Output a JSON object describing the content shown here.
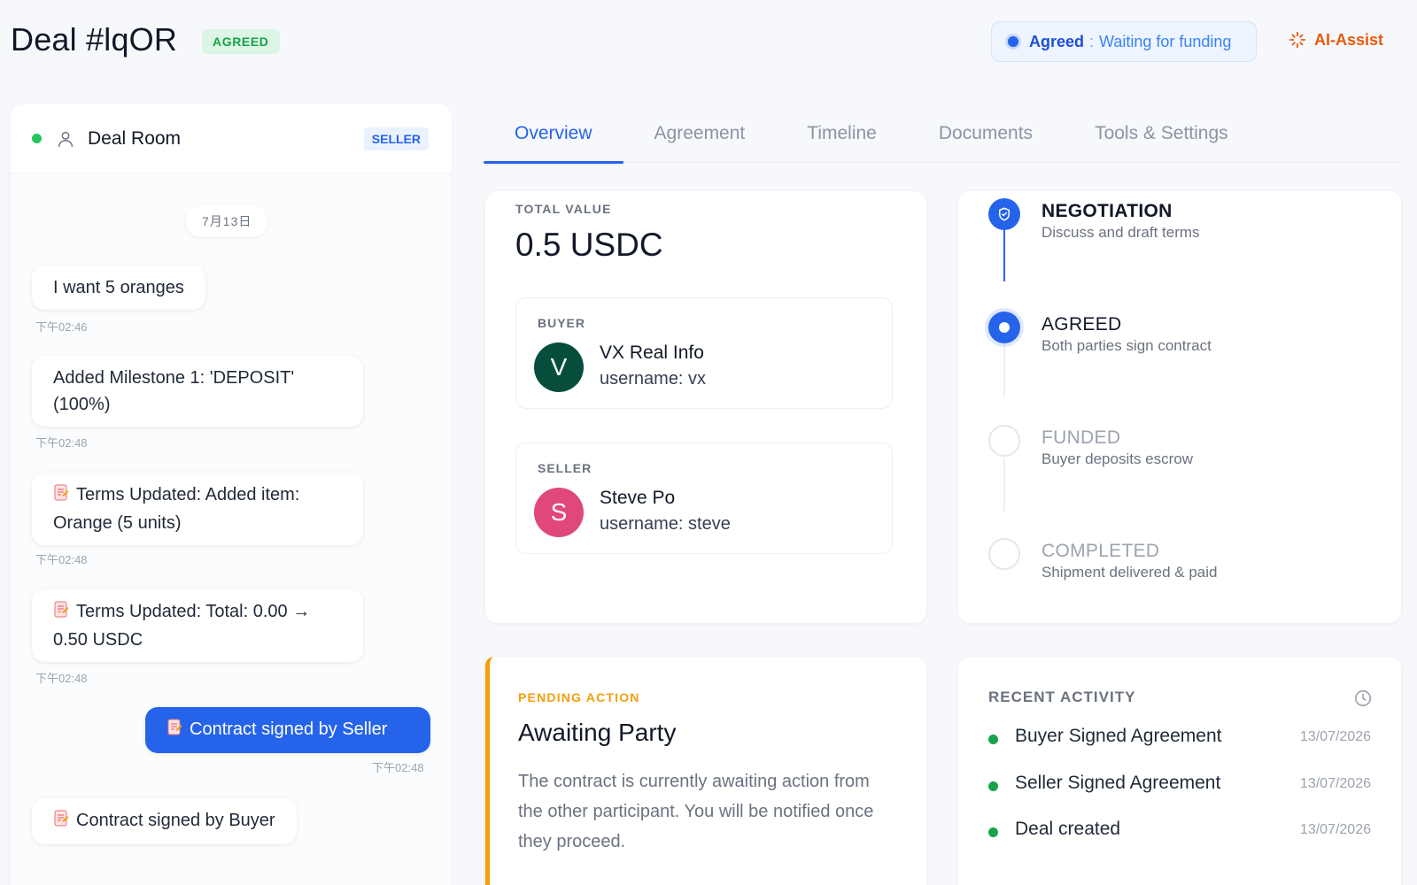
{
  "header": {
    "title": "Deal #lqOR",
    "status_chip": "AGREED",
    "state_label": "Agreed",
    "state_separator": ":",
    "state_desc": "Waiting for funding",
    "ai_assist": "AI-Assist"
  },
  "deal_room": {
    "title": "Deal Room",
    "role": "SELLER",
    "date": "7月13日",
    "messages": [
      {
        "text": "I want 5 oranges",
        "time": "下午02:46"
      },
      {
        "text": "Added Milestone 1: 'DEPOSIT' (100%)",
        "time": "下午02:48"
      },
      {
        "text": "Terms Updated: Added item: Orange (5 units)",
        "time": "下午02:48"
      },
      {
        "text": "Terms Updated: Total: 0.00 → 0.50 USDC",
        "time": "下午02:48"
      },
      {
        "text": "Contract signed by Seller",
        "time": "下午02:48"
      },
      {
        "text": "Contract signed by Buyer"
      }
    ]
  },
  "tabs": [
    {
      "label": "Overview"
    },
    {
      "label": "Agreement"
    },
    {
      "label": "Timeline"
    },
    {
      "label": "Documents"
    },
    {
      "label": "Tools & Settings"
    }
  ],
  "overview": {
    "total_value_label": "TOTAL VALUE",
    "total_value": "0.5 USDC",
    "buyer": {
      "label": "BUYER",
      "initial": "V",
      "name": "VX Real Info",
      "username": "username: vx",
      "avatar_color": "#064e3b"
    },
    "seller": {
      "label": "SELLER",
      "initial": "S",
      "name": "Steve Po",
      "username": "username: steve",
      "avatar_color": "#e0487a"
    }
  },
  "progress": {
    "steps": [
      {
        "title": "NEGOTIATION",
        "desc": "Discuss and draft terms",
        "state": "done"
      },
      {
        "title": "AGREED",
        "desc": "Both parties sign contract",
        "state": "current"
      },
      {
        "title": "FUNDED",
        "desc": "Buyer deposits escrow",
        "state": "pending"
      },
      {
        "title": "COMPLETED",
        "desc": "Shipment delivered & paid",
        "state": "pending"
      }
    ]
  },
  "pending_action": {
    "label": "PENDING ACTION",
    "title": "Awaiting Party",
    "text": "The contract is currently awaiting action from the other participant. You will be notified once they proceed."
  },
  "recent_activity": {
    "label": "RECENT ACTIVITY",
    "items": [
      {
        "text": "Buyer Signed Agreement",
        "date": "13/07/2026"
      },
      {
        "text": "Seller Signed Agreement",
        "date": "13/07/2026"
      },
      {
        "text": "Deal created",
        "date": "13/07/2026"
      }
    ]
  },
  "colors": {
    "accent": "#2563eb",
    "success": "#16a34a",
    "warning": "#f59e0b",
    "ai": "#ea580c"
  }
}
